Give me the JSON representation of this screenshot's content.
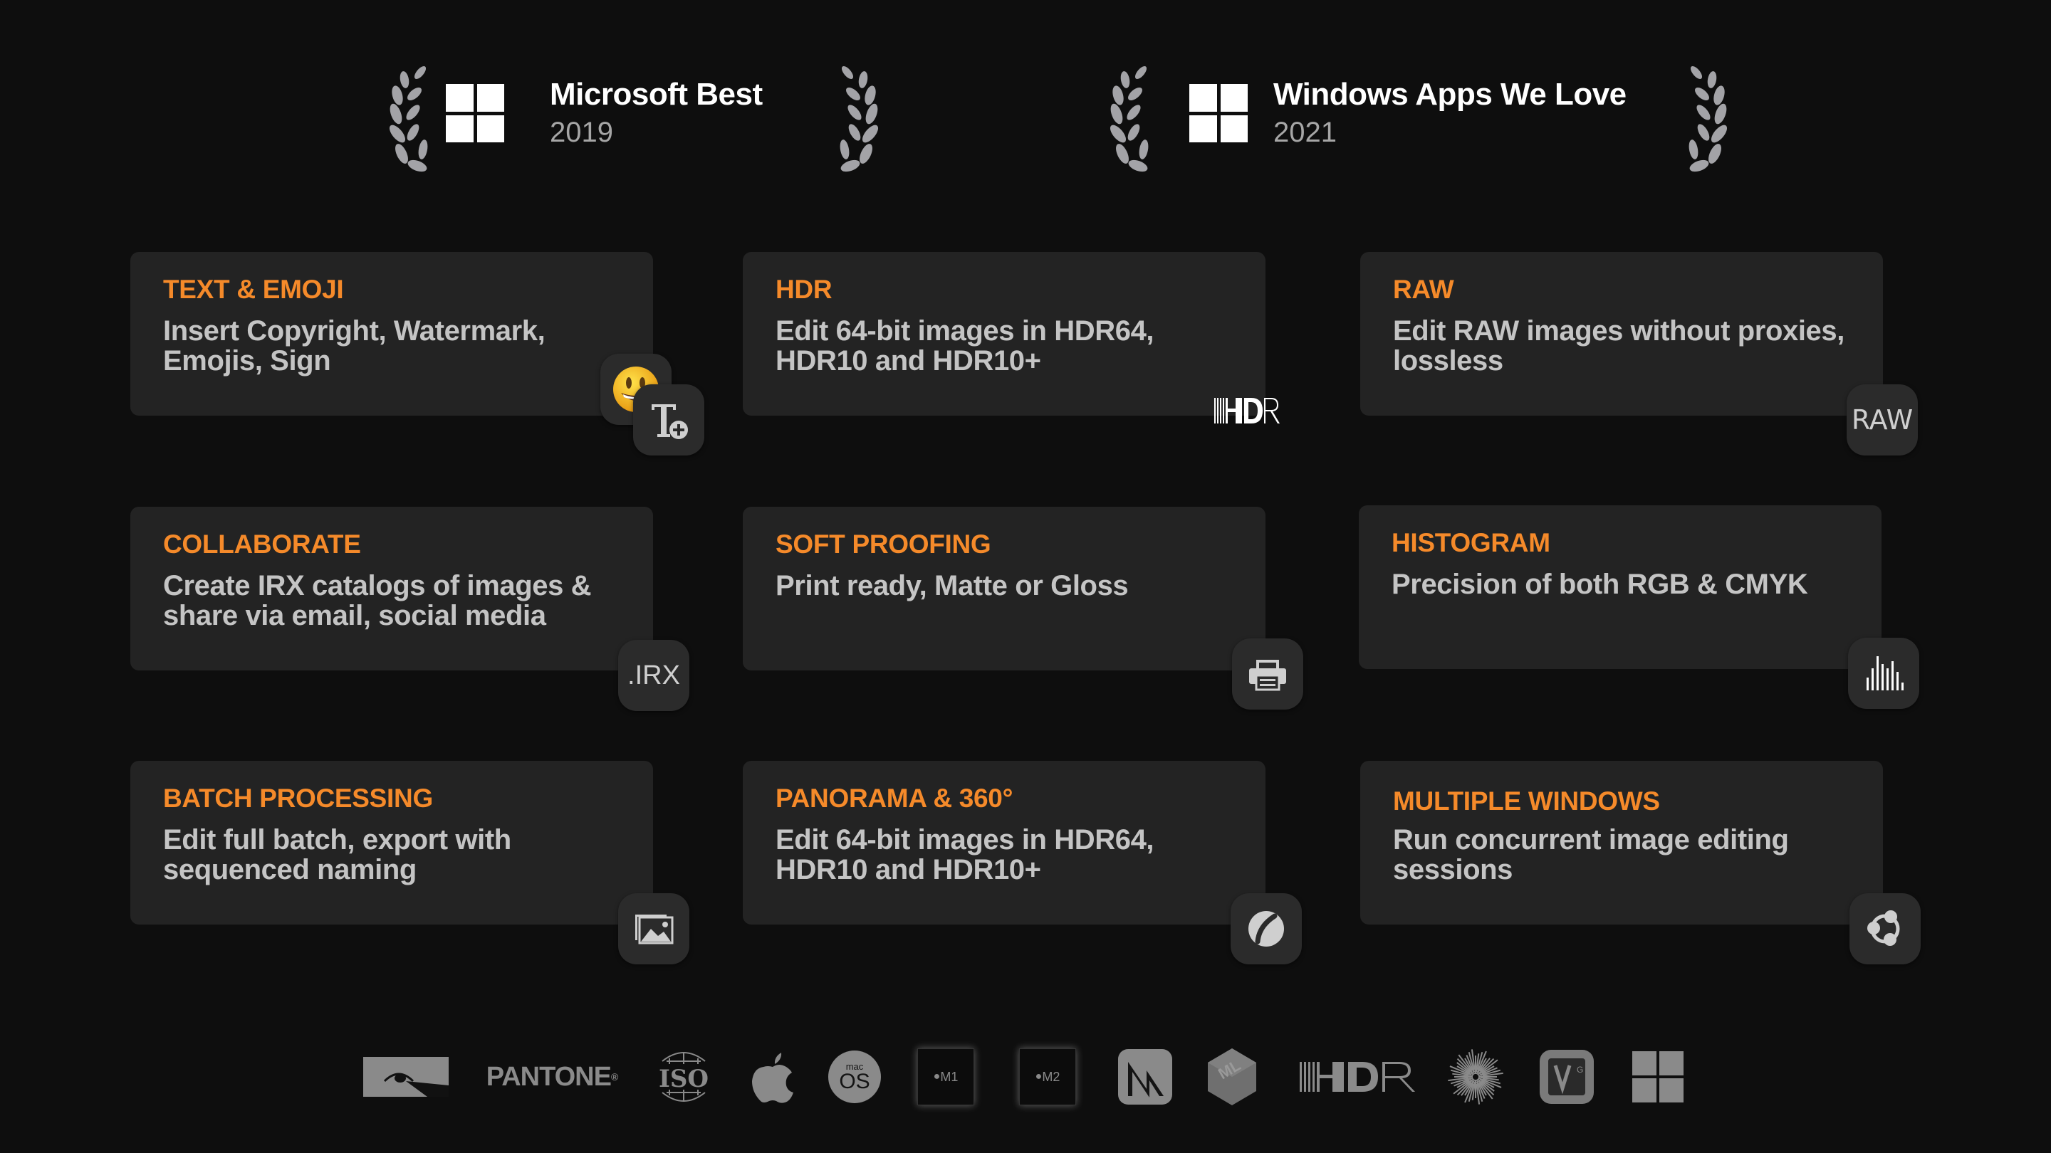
{
  "awards": [
    {
      "title": "Microsoft Best",
      "year": "2019"
    },
    {
      "title": "Windows Apps We Love",
      "year": "2021"
    }
  ],
  "colors": {
    "background": "#0e0e0e",
    "card": "#232323",
    "accent": "#f58a2a",
    "text": "#c4c4c4"
  },
  "features": [
    {
      "title": "TEXT & EMOJI",
      "description": "Insert Copyright, Watermark, Emojis, Sign",
      "icon": "text-add-icon"
    },
    {
      "title": "HDR",
      "description": "Edit 64-bit images in HDR64, HDR10 and HDR10+",
      "icon": "hdr-logo-icon",
      "icon_label": "HDR"
    },
    {
      "title": "RAW",
      "description": "Edit RAW images without proxies, lossless",
      "icon": "raw-icon",
      "icon_label": "RAW"
    },
    {
      "title": "COLLABORATE",
      "description": "Create IRX catalogs of images & share via email, social media",
      "icon": "irx-icon",
      "icon_label": ".IRX"
    },
    {
      "title": "SOFT PROOFING",
      "description": "Print ready, Matte or Gloss",
      "icon": "printer-icon"
    },
    {
      "title": "HISTOGRAM",
      "description": "Precision of both RGB & CMYK",
      "icon": "histogram-icon"
    },
    {
      "title": "BATCH PROCESSING",
      "description": "Edit full batch, export with sequenced naming",
      "icon": "images-icon"
    },
    {
      "title": "PANORAMA & 360°",
      "description": "Edit 64-bit images in HDR64, HDR10 and HDR10+",
      "icon": "panorama-sphere-icon"
    },
    {
      "title": "MULTIPLE WINDOWS",
      "description": "Run concurrent image editing sessions",
      "icon": "share-nodes-icon"
    }
  ],
  "footer_logos": [
    {
      "name": "eye-logo"
    },
    {
      "name": "pantone-logo",
      "label": "PANTONE",
      "mark": "®"
    },
    {
      "name": "iso-logo",
      "label": "ISO"
    },
    {
      "name": "apple-logo"
    },
    {
      "name": "macos-logo",
      "top": "mac",
      "bottom": "OS"
    },
    {
      "name": "m1-chip-logo",
      "label": "M1"
    },
    {
      "name": "m2-chip-logo",
      "label": "M2"
    },
    {
      "name": "metal-logo"
    },
    {
      "name": "coreml-logo",
      "label": "ML"
    },
    {
      "name": "hdr-logo",
      "label": "HDR"
    },
    {
      "name": "starburst-logo"
    },
    {
      "name": "vg-chip-logo",
      "label": "V",
      "sup": "G"
    },
    {
      "name": "windows-logo"
    }
  ]
}
